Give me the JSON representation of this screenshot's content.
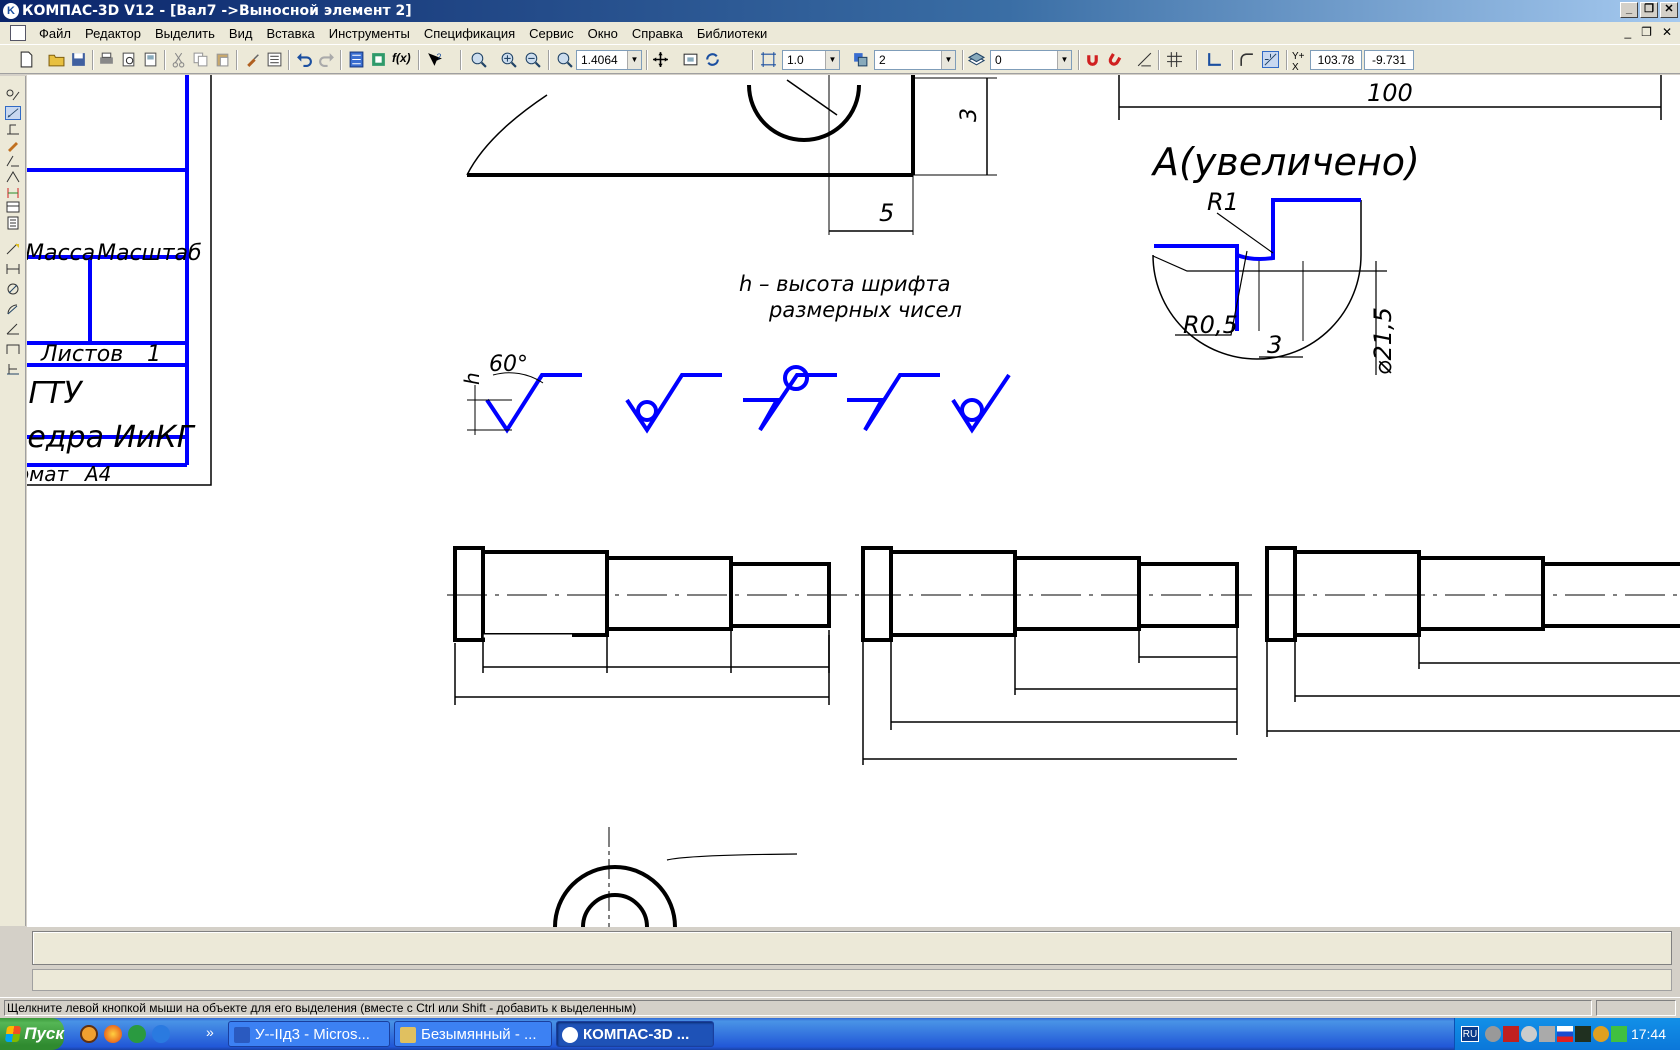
{
  "window": {
    "title": "КОМПАС-3D V12 - [Вал7 ->Выносной элемент 2]",
    "app_icon": "kompas-icon"
  },
  "menu": {
    "items": [
      "Файл",
      "Редактор",
      "Выделить",
      "Вид",
      "Вставка",
      "Инструменты",
      "Спецификация",
      "Сервис",
      "Окно",
      "Справка",
      "Библиотеки"
    ]
  },
  "toolbar": {
    "zoom_value": "1.4064",
    "scale_value": "1.0",
    "layer_style_value": "2",
    "layer_value": "0",
    "coord_x": "103.78",
    "coord_y": "-9.731"
  },
  "drawing": {
    "title_block": {
      "mass_label": "Масса",
      "scale_label": "Масштаб",
      "sheets_label": "Листов",
      "sheets_value": "1",
      "org_line1": "ДГТУ",
      "org_line2": "Кафедра ИиКГ",
      "format_label": "Формат",
      "format_value": "A4"
    },
    "dims": {
      "top_dim": "100",
      "dim_3": "3",
      "dim_5": "5",
      "detail_title": "A(увеличено)",
      "r1": "R1",
      "r05": "R0,5",
      "dim_3b": "3",
      "dia": "⌀21,5",
      "angle": "60°",
      "h_label": "h"
    },
    "note_line1": "h – высота шрифта",
    "note_line2": "размерных чисел"
  },
  "status": {
    "hint": "Щелкните левой кнопкой мыши на объекте для его выделения (вместе с Ctrl или Shift - добавить к выделенным)"
  },
  "taskbar": {
    "start_label": "Пуск",
    "tasks": [
      {
        "label": "У--IIд3 - Micros...",
        "active": false
      },
      {
        "label": "Безымянный - ...",
        "active": false
      },
      {
        "label": "КОМПАС-3D ...",
        "active": true
      }
    ],
    "lang": "RU",
    "clock": "17:44"
  },
  "colors": {
    "accent_blue": "#0000ff",
    "line_black": "#000000"
  }
}
